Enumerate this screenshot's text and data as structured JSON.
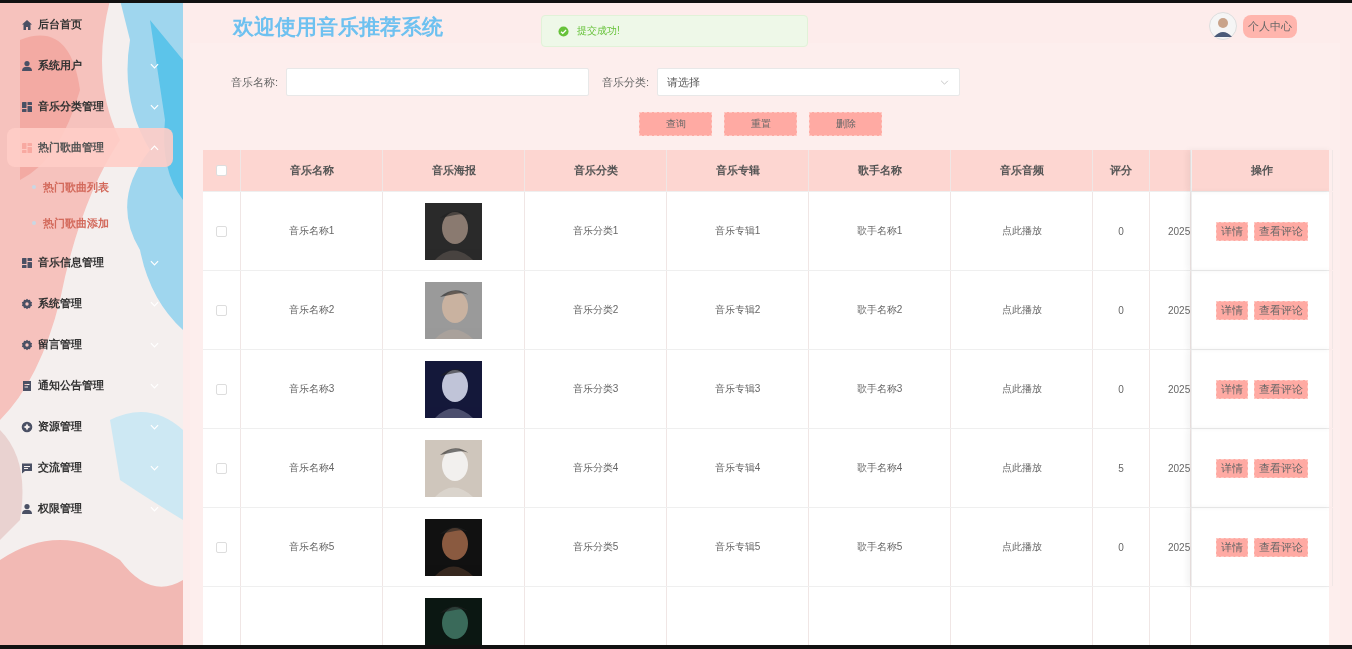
{
  "sidebar": {
    "items": [
      {
        "label": "后台首页",
        "selected": false
      },
      {
        "label": "系统用户",
        "selected": false,
        "expanded": false
      },
      {
        "label": "音乐分类管理",
        "selected": false,
        "expanded": false
      },
      {
        "label": "热门歌曲管理",
        "selected": true,
        "expanded": true,
        "children": [
          {
            "label": "热门歌曲列表",
            "selected": false
          },
          {
            "label": "热门歌曲添加",
            "selected": false
          }
        ]
      },
      {
        "label": "音乐信息管理",
        "selected": false,
        "expanded": false
      },
      {
        "label": "系统管理",
        "selected": false,
        "expanded": false
      },
      {
        "label": "留言管理",
        "selected": false,
        "expanded": false
      },
      {
        "label": "通知公告管理",
        "selected": false,
        "expanded": false
      },
      {
        "label": "资源管理",
        "selected": false,
        "expanded": false
      },
      {
        "label": "交流管理",
        "selected": false,
        "expanded": false
      },
      {
        "label": "权限管理",
        "selected": false,
        "expanded": false
      }
    ]
  },
  "header": {
    "title": "欢迎使用音乐推荐系统",
    "toast": "提交成功!",
    "profile_button": "个人中心"
  },
  "search": {
    "name_label": "音乐名称:",
    "category_label": "音乐分类:",
    "category_placeholder": "请选择",
    "buttons": [
      "查询",
      "重置",
      "删除"
    ]
  },
  "table": {
    "select_all_checked": false,
    "columns": [
      "音乐名称",
      "音乐海报",
      "音乐分类",
      "音乐专辑",
      "歌手名称",
      "音乐音频",
      "评分",
      "操作"
    ],
    "rows": [
      {
        "checked": false,
        "name": "音乐名称1",
        "poster": {
          "kind": "picture"
        },
        "category": "音乐分类1",
        "album": "音乐专辑1",
        "singer": "歌手名称1",
        "audio": "点此播放",
        "rating": "0",
        "column_9": "2025",
        "actions": [
          "详情",
          "查看评论"
        ]
      },
      {
        "checked": false,
        "name": "音乐名称2",
        "poster": {
          "kind": "picture"
        },
        "category": "音乐分类2",
        "album": "音乐专辑2",
        "singer": "歌手名称2",
        "audio": "点此播放",
        "rating": "0",
        "column_9": "2025",
        "actions": [
          "详情",
          "查看评论"
        ]
      },
      {
        "checked": false,
        "name": "音乐名称3",
        "poster": {
          "kind": "picture"
        },
        "category": "音乐分类3",
        "album": "音乐专辑3",
        "singer": "歌手名称3",
        "audio": "点此播放",
        "rating": "0",
        "column_9": "2025",
        "actions": [
          "详情",
          "查看评论"
        ]
      },
      {
        "checked": false,
        "name": "音乐名称4",
        "poster": {
          "kind": "picture"
        },
        "category": "音乐分类4",
        "album": "音乐专辑4",
        "singer": "歌手名称4",
        "audio": "点此播放",
        "rating": "5",
        "column_9": "2025",
        "actions": [
          "详情",
          "查看评论"
        ]
      },
      {
        "checked": false,
        "name": "音乐名称5",
        "poster": {
          "kind": "picture"
        },
        "category": "音乐分类5",
        "album": "音乐专辑5",
        "singer": "歌手名称5",
        "audio": "点此播放",
        "rating": "0",
        "column_9": "2025",
        "actions": [
          "详情",
          "查看评论"
        ]
      },
      {
        "poster": {
          "kind": "picture"
        }
      }
    ]
  }
}
